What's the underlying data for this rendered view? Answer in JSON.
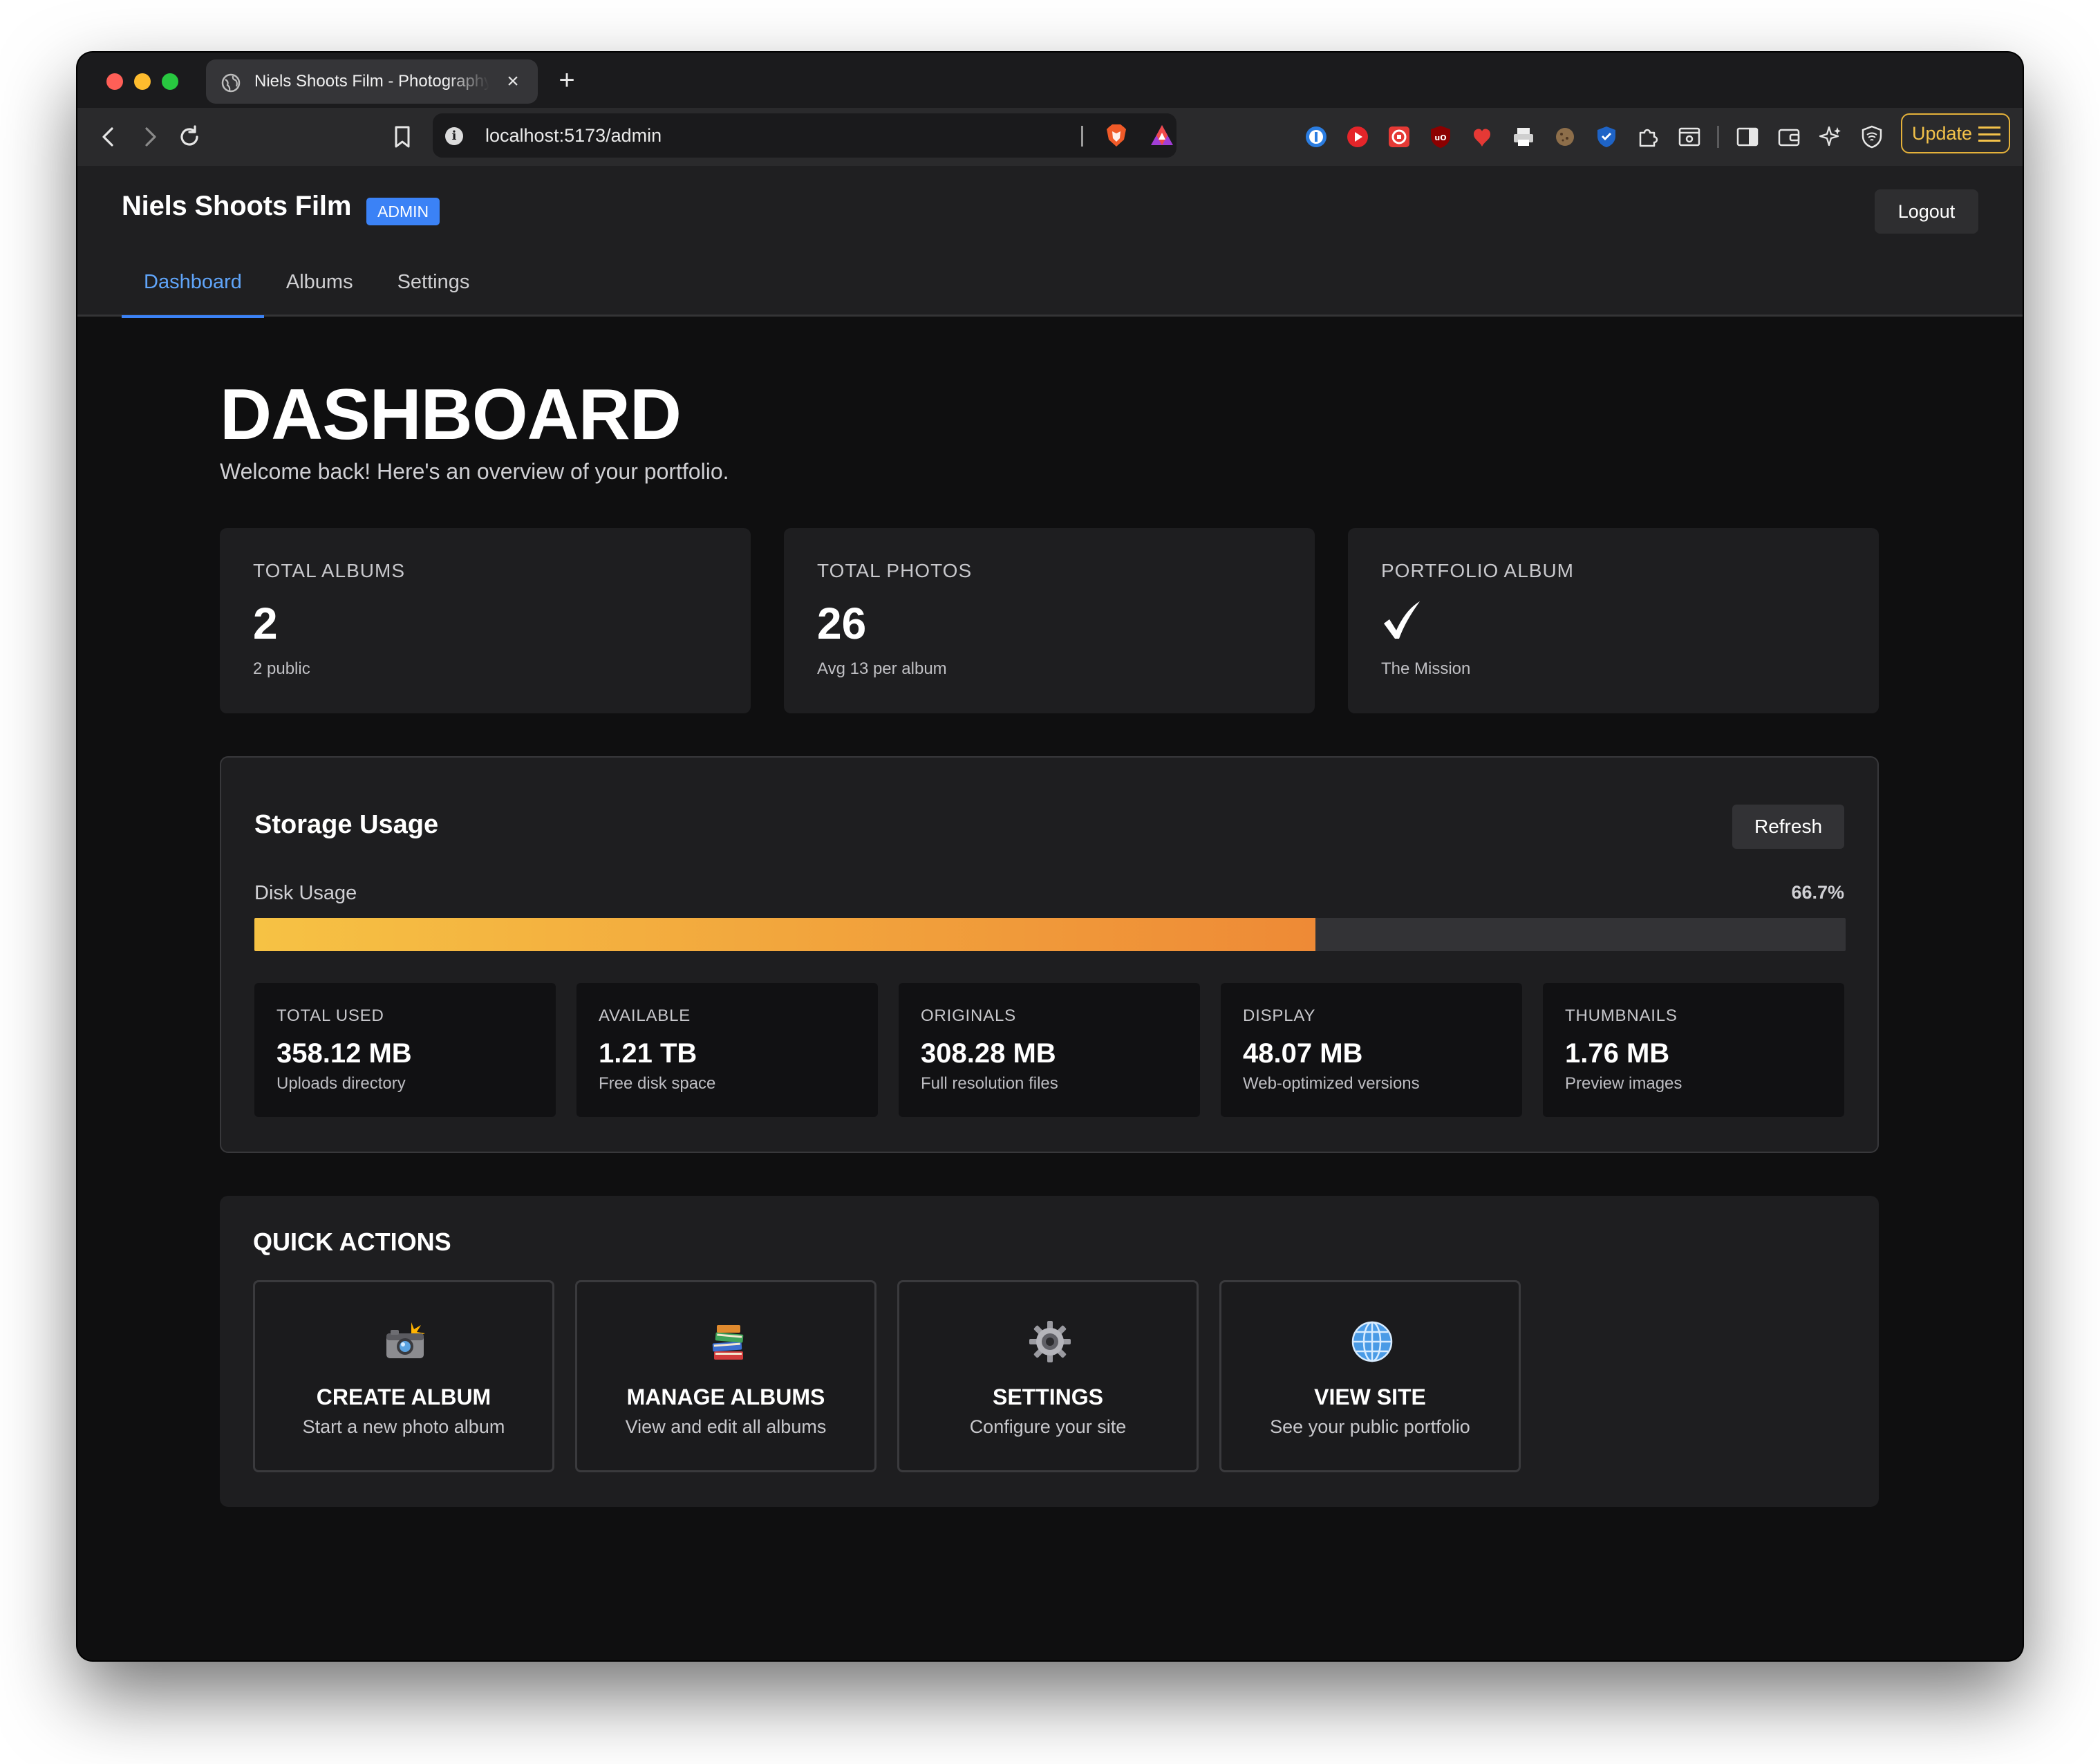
{
  "browser": {
    "tab_title": "Niels Shoots Film - Photography",
    "new_tab_symbol": "+",
    "close_symbol": "×",
    "url": "localhost:5173/admin",
    "update_label": "Update"
  },
  "header": {
    "brand": "Niels Shoots Film",
    "badge": "ADMIN",
    "logout_label": "Logout",
    "nav": [
      {
        "label": "Dashboard",
        "active": true
      },
      {
        "label": "Albums",
        "active": false
      },
      {
        "label": "Settings",
        "active": false
      }
    ]
  },
  "main": {
    "title": "DASHBOARD",
    "subtitle": "Welcome back! Here's an overview of your portfolio."
  },
  "stats": [
    {
      "label": "TOTAL ALBUMS",
      "value": "2",
      "sub": "2 public"
    },
    {
      "label": "TOTAL PHOTOS",
      "value": "26",
      "sub": "Avg 13 per album"
    },
    {
      "label": "PORTFOLIO ALBUM",
      "icon": "checkmark-icon",
      "sub": "The Mission"
    }
  ],
  "storage": {
    "title": "Storage Usage",
    "refresh_label": "Refresh",
    "disk_label": "Disk Usage",
    "disk_percent_text": "66.7%",
    "disk_percent_value": 66.7,
    "bar_colors": [
      "#f6c244",
      "#ee8a36"
    ],
    "items": [
      {
        "label": "TOTAL USED",
        "value": "358.12 MB",
        "sub": "Uploads directory"
      },
      {
        "label": "AVAILABLE",
        "value": "1.21 TB",
        "sub": "Free disk space"
      },
      {
        "label": "ORIGINALS",
        "value": "308.28 MB",
        "sub": "Full resolution files"
      },
      {
        "label": "DISPLAY",
        "value": "48.07 MB",
        "sub": "Web-optimized versions"
      },
      {
        "label": "THUMBNAILS",
        "value": "1.76 MB",
        "sub": "Preview images"
      }
    ]
  },
  "quick_actions": {
    "title": "QUICK ACTIONS",
    "items": [
      {
        "icon": "camera-flash-icon",
        "title": "CREATE ALBUM",
        "sub": "Start a new photo album"
      },
      {
        "icon": "books-icon",
        "title": "MANAGE ALBUMS",
        "sub": "View and edit all albums"
      },
      {
        "icon": "gear-icon",
        "title": "SETTINGS",
        "sub": "Configure your site"
      },
      {
        "icon": "globe-icon",
        "title": "VIEW SITE",
        "sub": "See your public portfolio"
      }
    ]
  },
  "colors": {
    "accent": "#3b82f6",
    "background": "#0f0f10",
    "card": "#1e1e20",
    "update": "#f3c24a"
  }
}
